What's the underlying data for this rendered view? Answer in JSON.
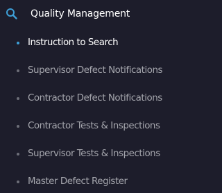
{
  "menu": {
    "header": {
      "icon": "search-icon",
      "title": "Quality Management"
    },
    "items": [
      {
        "label": "Instruction to Search",
        "active": true
      },
      {
        "label": "Supervisor Defect Notifications",
        "active": false
      },
      {
        "label": "Contractor Defect Notifications",
        "active": false
      },
      {
        "label": "Contractor Tests & Inspections",
        "active": false
      },
      {
        "label": "Supervisor Tests & Inspections",
        "active": false
      },
      {
        "label": "Master Defect Register",
        "active": false
      }
    ]
  },
  "colors": {
    "background": "#1d1d2b",
    "accent": "#3ea0d8",
    "text_active": "#ffffff",
    "text_inactive": "#a5a6ad",
    "bullet_inactive": "#6d6e78"
  }
}
